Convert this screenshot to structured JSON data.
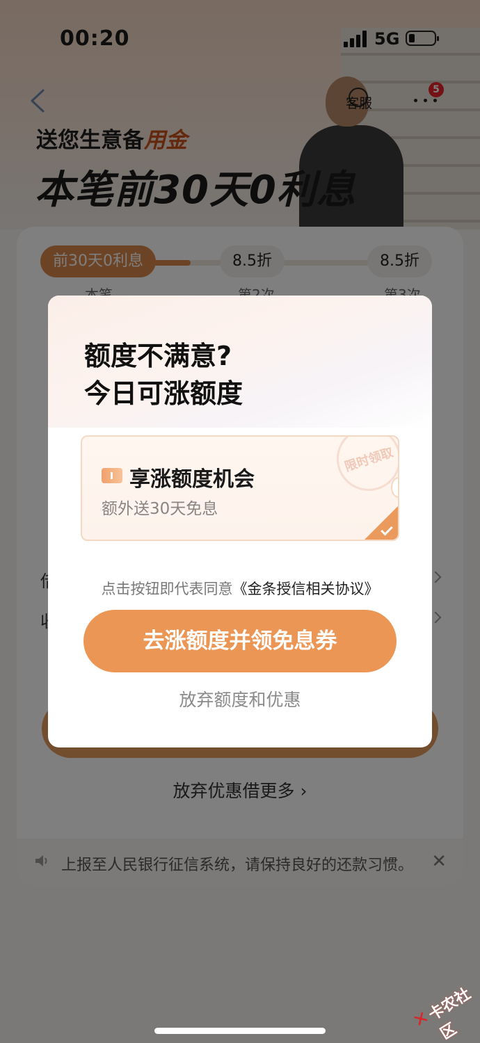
{
  "status_bar": {
    "time": "00:20",
    "network": "5G"
  },
  "header": {
    "service_label": "客服",
    "more_badge": "5"
  },
  "promo": {
    "subtitle_prefix": "送您生意备",
    "subtitle_highlight": "用金",
    "title": "本笔前30天0利息"
  },
  "steps": [
    {
      "pill": "前30天0利息",
      "label": "本笔",
      "active": true
    },
    {
      "pill": "8.5折",
      "label": "第2次",
      "active": false
    },
    {
      "pill": "8.5折",
      "label": "第3次",
      "active": false
    }
  ],
  "background_rows": [
    {
      "label": "借"
    },
    {
      "label": "收"
    }
  ],
  "giveup_more": "放弃优惠借更多",
  "notice": {
    "text": "上报至人民银行征信系统，请保持良好的还款习惯。",
    "close": "✕"
  },
  "modal": {
    "title_line1": "额度不满意?",
    "title_line2": "今日可涨额度",
    "coupon": {
      "title": "享涨额度机会",
      "subtitle": "额外送30天免息",
      "stamp": "限时领取"
    },
    "agreement_prefix": "点击按钮即代表同意",
    "agreement_link": "《金条授信相关协议》",
    "cta": "去涨额度并领免息券",
    "giveup": "放弃额度和优惠"
  },
  "watermark": {
    "text": "卡农社区"
  },
  "colors": {
    "accent": "#eb9655",
    "badge": "#e8232a",
    "highlight": "#c9501a"
  }
}
